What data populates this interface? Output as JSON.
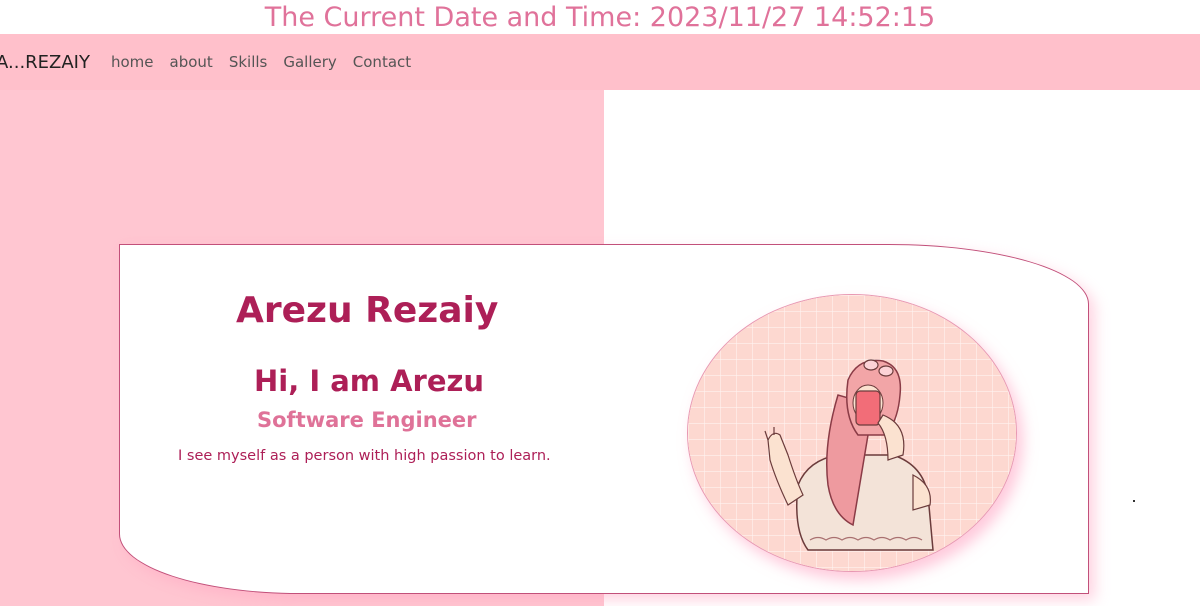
{
  "header": {
    "datetime": "The Current Date and Time: 2023/11/27 14:52:15"
  },
  "nav": {
    "brand": "A...REZAIY",
    "links": [
      "home",
      "about",
      "Skills",
      "Gallery",
      "Contact"
    ]
  },
  "hero": {
    "name": "Arezu Rezaiy",
    "greeting": "Hi, I am Arezu",
    "role": "Software Engineer",
    "bio": "I see myself as a person with high passion to learn."
  },
  "colors": {
    "accent": "#ad1f57",
    "accent_light": "#df7298",
    "nav_bg": "#ffc0cb",
    "left_panel_bg": "#ffc6d1"
  },
  "icons": {
    "avatar": "hijab-girl-illustration"
  }
}
